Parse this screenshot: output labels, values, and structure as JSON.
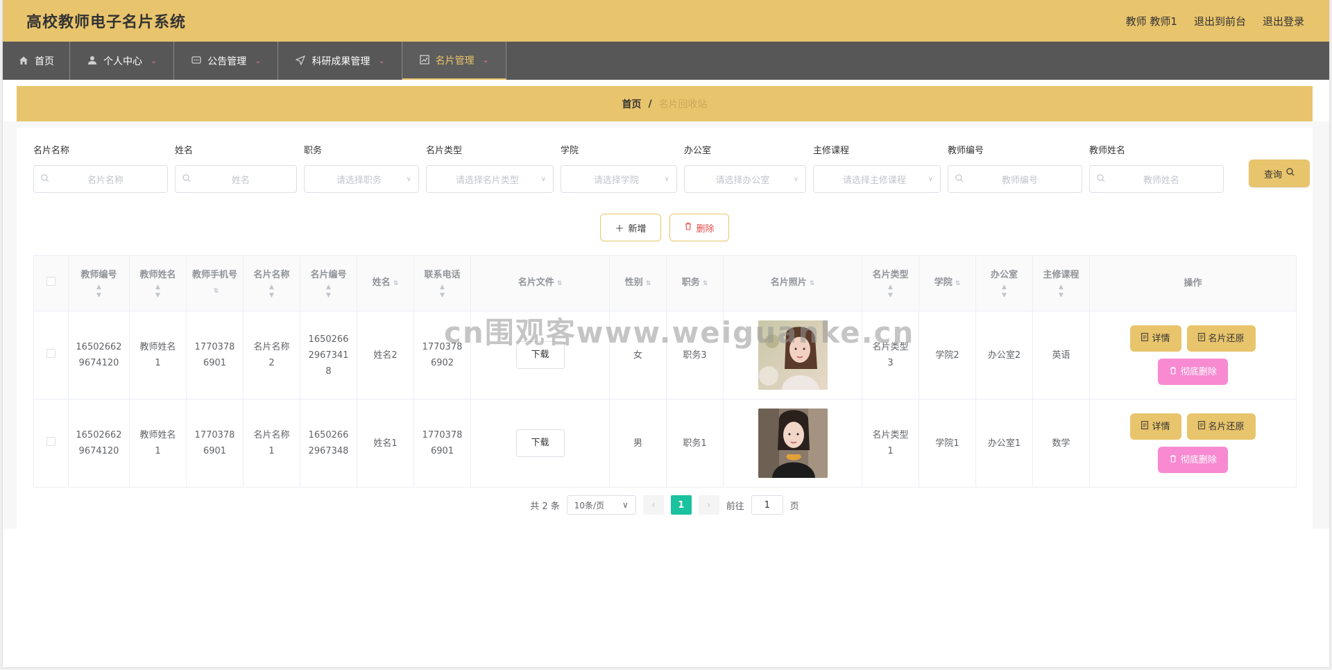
{
  "app": {
    "title": "高校教师电子名片系统",
    "user_label": "教师 教师1",
    "to_front_label": "退出到前台",
    "logout_label": "退出登录"
  },
  "nav": {
    "items": [
      {
        "label": "首页",
        "icon": "home-icon"
      },
      {
        "label": "个人中心",
        "icon": "user-icon"
      },
      {
        "label": "公告管理",
        "icon": "message-icon"
      },
      {
        "label": "科研成果管理",
        "icon": "send-icon"
      },
      {
        "label": "名片管理",
        "icon": "chart-icon",
        "active": true
      }
    ]
  },
  "breadcrumb": {
    "home": "首页",
    "separator": "/",
    "current": "名片回收站"
  },
  "search": {
    "fields": [
      {
        "label": "名片名称",
        "placeholder": "名片名称",
        "type": "input"
      },
      {
        "label": "姓名",
        "placeholder": "姓名",
        "type": "input"
      },
      {
        "label": "职务",
        "placeholder": "请选择职务",
        "type": "select"
      },
      {
        "label": "名片类型",
        "placeholder": "请选择名片类型",
        "type": "select"
      },
      {
        "label": "学院",
        "placeholder": "请选择学院",
        "type": "select"
      },
      {
        "label": "办公室",
        "placeholder": "请选择办公室",
        "type": "select"
      },
      {
        "label": "主修课程",
        "placeholder": "请选择主修课程",
        "type": "select"
      },
      {
        "label": "教师编号",
        "placeholder": "教师编号",
        "type": "input"
      },
      {
        "label": "教师姓名",
        "placeholder": "教师姓名",
        "type": "input"
      }
    ],
    "query_label": "查询"
  },
  "toolbar": {
    "add_label": "新增",
    "delete_label": "删除"
  },
  "table": {
    "headers": [
      "教师编号",
      "教师姓名",
      "教师手机号",
      "名片名称",
      "名片编号",
      "姓名",
      "联系电话",
      "名片文件",
      "性别",
      "职务",
      "名片照片",
      "名片类型",
      "学院",
      "办公室",
      "主修课程",
      "操作"
    ],
    "rows": [
      {
        "teacher_no": "1650266296741 20",
        "teacher_no_l1": "16502662",
        "teacher_no_l2": "9674120",
        "teacher_name_l1": "教师姓名",
        "teacher_name_l2": "1",
        "teacher_phone_l1": "1770378",
        "teacher_phone_l2": "6901",
        "card_name_l1": "名片名称",
        "card_name_l2": "2",
        "card_no_l1": "1650266",
        "card_no_l2": "2967341",
        "card_no_l3": "8",
        "name": "姓名2",
        "phone_l1": "1770378",
        "phone_l2": "6902",
        "file_label": "下载",
        "gender": "女",
        "position": "职务3",
        "card_type_l1": "名片类型",
        "card_type_l2": "3",
        "college": "学院2",
        "office": "办公室2",
        "course": "英语"
      },
      {
        "teacher_no_l1": "16502662",
        "teacher_no_l2": "9674120",
        "teacher_name_l1": "教师姓名",
        "teacher_name_l2": "1",
        "teacher_phone_l1": "1770378",
        "teacher_phone_l2": "6901",
        "card_name_l1": "名片名称",
        "card_name_l2": "1",
        "card_no_l1": "1650266",
        "card_no_l2": "2967348",
        "card_no_l3": "",
        "name": "姓名1",
        "phone_l1": "1770378",
        "phone_l2": "6901",
        "file_label": "下载",
        "gender": "男",
        "position": "职务1",
        "card_type_l1": "名片类型",
        "card_type_l2": "1",
        "college": "学院1",
        "office": "办公室1",
        "course": "数学"
      }
    ],
    "ops": {
      "detail": "详情",
      "restore": "名片还原",
      "purge": "彻底删除"
    }
  },
  "pager": {
    "total": "共 2 条",
    "size": "10条/页",
    "current": "1",
    "goto_prefix": "前往",
    "goto_value": "1",
    "goto_suffix": "页"
  },
  "watermark": "cn围观客www.weiguanke.cn",
  "colors": {
    "brand": "#e8c46c",
    "nav": "#575757",
    "pink": "#f78ad1",
    "active_page": "#1ac29f"
  }
}
